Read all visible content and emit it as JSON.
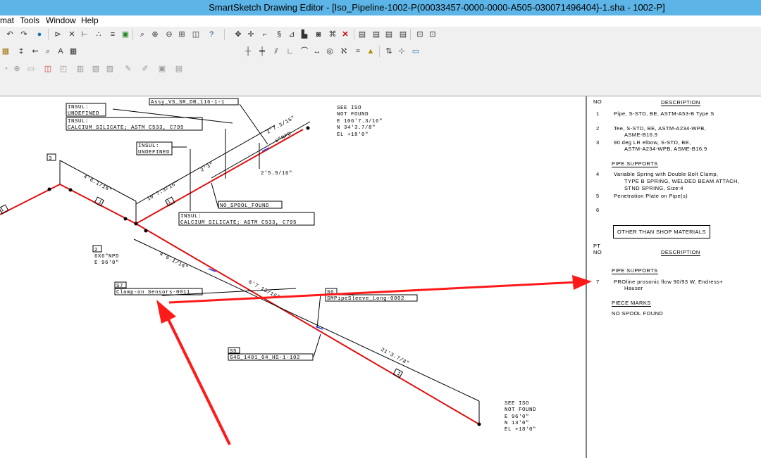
{
  "window": {
    "title": "SmartSketch Drawing Editor - [Iso_Pipeline-1002-P(00033457-0000-0000-A505-030071496404}-1.sha - 1002-P]"
  },
  "menu": [
    "mat",
    "Tools",
    "Window",
    "Help"
  ],
  "toolbar_icons": {
    "row1": [
      "undo-icon",
      "redo-icon",
      "globe-icon",
      "select-icon",
      "x-select-icon",
      "dim-icon",
      "points-icon",
      "layers-icon",
      "chart-icon",
      "zoom-area-icon",
      "zoom-in-icon",
      "zoom-out-icon",
      "fit-icon",
      "view-icon",
      "help-icon",
      "pan-icon",
      "rotate-icon",
      "scale-icon",
      "mirror-icon",
      "align-icon",
      "group-icon",
      "break-icon",
      "delete-icon",
      "copy-icon",
      "paste-icon",
      "front-icon",
      "back-icon",
      "grid-icon",
      "snap-icon"
    ],
    "row2": [
      "ruler-icon",
      "text-icon",
      "search-icon",
      "label-icon",
      "table-icon"
    ],
    "row3": [
      "circle-icon",
      "target-icon",
      "rect-icon",
      "split-icon",
      "frame-icon",
      "layer-icon",
      "note-icon",
      "pen-icon",
      "brush-icon",
      "save-icon",
      "print-icon"
    ],
    "row2b": [
      "line-icon",
      "cross-icon",
      "parallel-icon",
      "angle-icon",
      "tangent-icon",
      "arrow-icon",
      "circle-point-icon",
      "symbol-icon",
      "equal-icon",
      "lock-icon",
      "relate-icon",
      "connect-icon",
      "group-box-icon"
    ]
  },
  "drawing": {
    "labels": {
      "assy": "Assy_VS_SR_DB_116-1-1",
      "insul1_a": "INSUL:",
      "insul1_b": "UNDEFINED",
      "insul1_c": "INSUL:",
      "insul1_d": "CALCIUM SILICATE; ASTM C533, C795",
      "insul2_a": "INSUL:",
      "insul2_b": "UNDEFINED",
      "insul3_a": "INSUL:",
      "insul3_b": "CALCIUM SILICATE; ASTM C533, C795",
      "iso_top_1": "SEE ISO",
      "iso_top_2": "NOT FOUND",
      "iso_top_3": "E 106'7.3/16\"",
      "iso_top_4": "N 34'3.7/8\"",
      "iso_top_5": "EL +18'0\"",
      "iso_bot_1": "SEE ISO",
      "iso_bot_2": "NOT FOUND",
      "iso_bot_3": "E 96'0\"",
      "iso_bot_4": "N 13'0\"",
      "iso_bot_5": "EL +18'0\"",
      "dim_1": "2'7.3/16\"",
      "dim_6npd": "6\"NPD",
      "dim_23": "2'3\"",
      "dim_259": "2'5.9/16\"",
      "dim_1073": "10'7.3/16\"",
      "dim_4611": "4'6.1/16\"",
      "dim_4612": "4'6.1/16\"",
      "dim_6713": "6'7.13/16\"",
      "dim_2137": "21'3.7/8\"",
      "no_spool": "NO_SPOOL_FOUND",
      "tag_3": "3",
      "tag_2": "2",
      "tag_2b": "2",
      "tag_1a": "1",
      "tag_1b": "1",
      "tag_1c": "1",
      "tag_1d": "1",
      "node2_a": "2",
      "node2_b": "6X6\"NPD",
      "node2_c": "E 96'0\"",
      "s7_tag": "S7",
      "s7_label": "Clamp-on Sensors-0011",
      "s6_tag": "S6",
      "s6_label": "SMPipeSleeve_Long-0002",
      "s5_tag": "S5",
      "s5_label": "G4G_1401_04_HS-1-102"
    }
  },
  "side_panel": {
    "header_no": "NO",
    "header_desc": "DESCRIPTION",
    "items": [
      {
        "no": "1",
        "text": "Pipe, S-STD, BE, ASTM-A53-B Type S"
      },
      {
        "no": "2",
        "text": "Tee, S-STD, BE, ASTM-A234-WPB,",
        "text2": "ASME-B16.9"
      },
      {
        "no": "3",
        "text": "90 deg LR elbow, S-STD, BE,",
        "text2": "ASTM-A234-WPB, ASME-B16.9"
      }
    ],
    "pipe_supports_title": "PIPE SUPPORTS",
    "support_items": [
      {
        "no": "4",
        "text": "Variable Spring with Double Bolt Clamp,",
        "text2": "TYPE B SPRING, WELDED BEAM ATTACH,",
        "text3": "STND SPRING, Size:4"
      },
      {
        "no": "5",
        "text": "Penetration Plate on Pipe(s)"
      },
      {
        "no": "6",
        "text": ""
      }
    ],
    "other_title": "OTHER THAN SHOP MATERIALS",
    "pt": "PT",
    "pt_no": "NO",
    "pt_desc": "DESCRIPTION",
    "pipe_supports2": "PIPE SUPPORTS",
    "item7_no": "7",
    "item7_a": "PROline prosonic flow 90/93 W, Endress+",
    "item7_b": "Hauser",
    "piece_marks": "PIECE MARKS",
    "no_spool": "NO SPOOL FOUND"
  }
}
